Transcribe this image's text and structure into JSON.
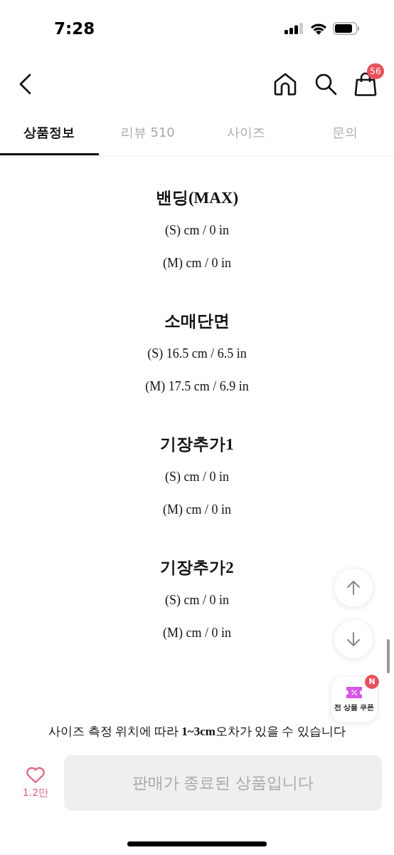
{
  "status_bar": {
    "time": "7:28"
  },
  "nav": {
    "cart_count": "56"
  },
  "tabs": [
    {
      "label": "상품정보",
      "selected": true
    },
    {
      "label": "리뷰 510",
      "selected": false
    },
    {
      "label": "사이즈",
      "selected": false
    },
    {
      "label": "문의",
      "selected": false
    }
  ],
  "sections": [
    {
      "title": "밴딩(MAX)",
      "lines": [
        "(S) cm / 0 in",
        "(M) cm / 0 in"
      ]
    },
    {
      "title": "소매단면",
      "lines": [
        "(S) 16.5 cm / 6.5 in",
        "(M) 17.5 cm / 6.9 in"
      ]
    },
    {
      "title": "기장추가1",
      "lines": [
        "(S) cm / 0 in",
        "(M) cm / 0 in"
      ]
    },
    {
      "title": "기장추가2",
      "lines": [
        "(S) cm / 0 in",
        "(M) cm / 0 in"
      ]
    }
  ],
  "note": "사이즈 측정 위치에 따라 **1~3cm**오차가 있을 수 있습니다",
  "coupon": {
    "label": "전 상품 쿠폰",
    "badge": "N"
  },
  "bottom_bar": {
    "like_count": "1.2만",
    "buy_button": {
      "label": "판매가 종료된 상품입니다",
      "disabled": true
    }
  }
}
